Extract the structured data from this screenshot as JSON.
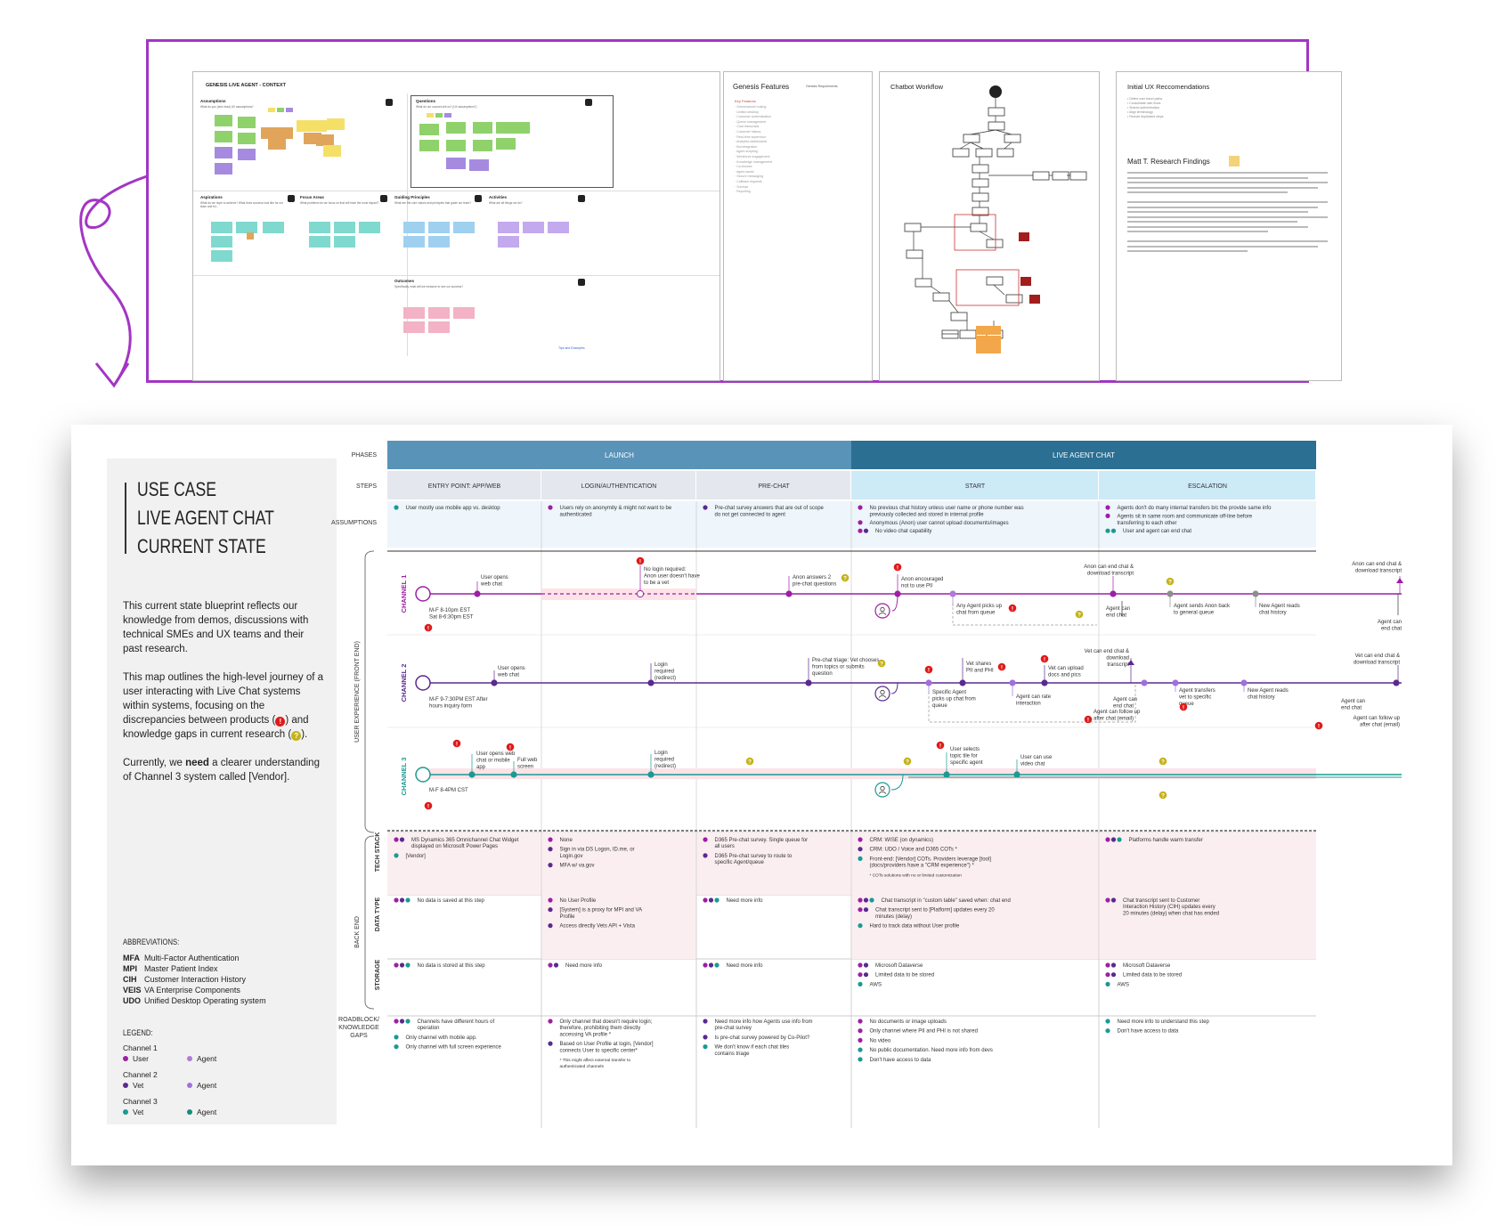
{
  "top": {
    "board_title": "GENESIS LIVE AGENT - CONTEXT",
    "sections": [
      {
        "title": "Assumptions",
        "sub": "What do you (tech lead) UX assumptions?"
      },
      {
        "title": "Questions",
        "sub": "What do our sources tell us? (UX assumptions?)"
      },
      {
        "title": "Aspirations",
        "sub": "What do we hope to achieve? What does success look like for our team and for..."
      },
      {
        "title": "Focus Areas",
        "sub": "What problems do we focus on that will have the most impact?"
      },
      {
        "title": "Guiding Principles",
        "sub": "What are the core values and principles that guide our team?"
      },
      {
        "title": "Activities",
        "sub": "What are all things we do?"
      },
      {
        "title": "Outcomes",
        "sub": "Specifically, what will we measure to see our success?"
      }
    ],
    "features_title": "Genesis Features",
    "features_small": "Genesis Requirements",
    "features_head": "Key Features",
    "features_items": [
      "Omnichannel routing",
      "Unified desktop",
      "Customer authentication",
      "Queue management",
      "Chat transcripts",
      "Customer history",
      "Real-time supervisor",
      "Analytics dashboards",
      "Bot integration",
      "Agent scripting",
      "Workforce engagement",
      "Knowledge management",
      "Co-browse",
      "Agent assist",
      "Secure messaging",
      "Callback requests",
      "Surveys",
      "Reporting"
    ],
    "chatbot_title": "Chatbot Workflow",
    "ux_title": "Initial UX Reccomendations",
    "ux_items": [
      "Define user travel paths",
      "Consolidate user flows",
      "Shared authentication",
      "Align terminology",
      "Reduce duplicated steps"
    ],
    "matt_title": "Matt T. Research Findings",
    "rec_tag": "Tips and Examples"
  },
  "sidebar": {
    "title_1": "USE CASE",
    "title_2": "LIVE AGENT CHAT",
    "title_3": "CURRENT STATE",
    "para1": "This current state blueprint reflects our knowledge from demos, discussions with technical SMEs and UX teams and their past research.",
    "para2_a": "This map outlines the high-level journey of a user interacting with Live Chat systems within systems, focusing on the discrepancies between products (",
    "para2_b": ") and knowledge gaps in current research (",
    "para2_c": ").",
    "para3_a": "Currently, we ",
    "para3_b": "need",
    "para3_c": " a clearer understanding of Channel 3 system called [Vendor].",
    "abbr_title": "ABBREVIATIONS:",
    "abbr": [
      {
        "k": "MFA",
        "v": "Multi-Factor Authentication"
      },
      {
        "k": "MPI",
        "v": "Master Patient Index"
      },
      {
        "k": "CIH",
        "v": "Customer Interaction History"
      },
      {
        "k": "VEIS",
        "v": "VA Enterprise Components"
      },
      {
        "k": "UDO",
        "v": "Unified Desktop Operating system"
      }
    ],
    "legend_title": "LEGEND:",
    "legend": [
      {
        "ch": "Channel 1",
        "a": "User",
        "b": "Agent",
        "ca": "#9d1fa5",
        "cb": "#b07ad8"
      },
      {
        "ch": "Channel 2",
        "a": "Vet",
        "b": "Agent",
        "ca": "#5a2a8f",
        "cb": "#a070de"
      },
      {
        "ch": "Channel 3",
        "a": "Vet",
        "b": "Agent",
        "ca": "#1a9a92",
        "cb": "#178a7d"
      }
    ]
  },
  "rows": {
    "phases": "PHASES",
    "steps": "STEPS",
    "assumptions": "ASSUMPTIONS",
    "ux": "USER EXPERIENCE (FRONT END)",
    "backend": "BACK END",
    "tech": "TECH STACK",
    "data": "DATA TYPE",
    "storage": "STORAGE",
    "roadblock_1": "ROADBLOCK/",
    "roadblock_2": "KNOWLEDGE",
    "roadblock_3": "GAPS"
  },
  "phases": [
    "LAUNCH",
    "LIVE AGENT CHAT"
  ],
  "steps": [
    "ENTRY POINT: APP/WEB",
    "LOGIN/AUTHENTICATION",
    "PRE-CHAT",
    "START",
    "ESCALATION"
  ],
  "channels": [
    "CHANNEL 1",
    "CHANNEL 2",
    "CHANNEL 3"
  ],
  "assumptions": [
    [
      "User mostly use mobile app vs. desktop"
    ],
    [
      "Users rely on anonymity & might not want to be authenticated"
    ],
    [
      "Pre-chat survey answers that are out of scope do not get connected to agent"
    ],
    [
      "No previous chat history unless user name or phone number was previously collected and stored in internal profile",
      "Anonymous (Anon) user cannot upload documents/images",
      "No video chat capability"
    ],
    [
      "Agents don't do many internal transfers b/c the provide same info",
      "Agents sit in same room and communicate off-line before transferring to each other",
      "User and agent can end chat"
    ]
  ],
  "ch1": {
    "hours": "M-F 8-10pm EST Sat 8-6:30pm EST",
    "labels": [
      "User opens web chat",
      "No login required: Anon user doesn't have to be a vet",
      "Anon answers 2 pre-chat questions",
      "Anon encouraged not to use PII",
      "Any Agent picks up chat from queue",
      "Agent can end chat",
      "Anon can end chat & download transcript",
      "Agent sends Anon back to general queue",
      "New Agent reads chat history",
      "Anon can end chat & download transcript",
      "Agent can end chat"
    ]
  },
  "ch2": {
    "hours": "M-F 9-7:30PM EST After hours inquiry form",
    "labels": [
      "User opens web chat",
      "Login required (redirect)",
      "Pre-chat triage: Vet chooses from topics or submits question",
      "Vet shares PII and PHI",
      "Vet can upload docs and pics",
      "Vet can end chat & download transcript",
      "Specific Agent picks up chat from queue",
      "Agent can rate interaction",
      "Agent can end chat",
      "Agent can follow up after chat (email)",
      "Agent transfers vet to specific queue",
      "New Agent reads chat history",
      "Vet can end chat & download transcript",
      "Agent can end chat",
      "Agent can follow up after chat (email)"
    ]
  },
  "ch3": {
    "hours": "M-F 8-4PM CST",
    "labels": [
      "User opens web chat or mobile app",
      "Full web screen",
      "Login required (redirect)",
      "User selects topic tile for specific agent",
      "User can use video chat"
    ]
  },
  "tech": [
    [
      "MS Dynamics 365 Omnichannel Chat Widget displayed on Microsoft Power Pages",
      "[Vendor]"
    ],
    [
      "None",
      "Sign in via DS Logon, ID.me, or Login.gov",
      "MFA w/ va.gov"
    ],
    [
      "D365 Pre-chat survey. Single queue for all users",
      "D365 Pre-chat survey to route to specific Agent/queue"
    ],
    [
      "CRM: WISE (on dynamics)",
      "CRM: UDO / Voice and D365 COTs *",
      "Front-end: [Vendor] COTs. Providers leverage [tool] (docs/providers have a \"CRM experience\") *",
      "* COTs solutions with no or limited customization"
    ],
    [
      "Platforms handle warm transfer"
    ]
  ],
  "datatype": [
    [
      "No data is saved at this step"
    ],
    [
      "No User Profile",
      "[System] is a proxy for MPI and VA Profile",
      "Access directly Vets API + Vista"
    ],
    [
      "Need more info"
    ],
    [
      "Chat transcript in \"custom table\" saved when: chat end",
      "Chat transcript sent to [Platform] updates every 20 minutes (delay)",
      "Hard to track data without User profile"
    ],
    [
      "Chat transcript sent to Customer Interaction History (CIH) updates every 20 minutes (delay) when chat has ended"
    ]
  ],
  "storage": [
    [
      "No data is stored at this step"
    ],
    [
      "Need more info"
    ],
    [
      "Need more info"
    ],
    [
      "Microsoft Dataverse",
      "Limited data to be stored",
      "AWS"
    ],
    [
      "Microsoft Dataverse",
      "Limited data to be stored",
      "AWS"
    ]
  ],
  "gaps": [
    [
      "Channels have different hours of operation",
      "Only channel with mobile app.",
      "Only channel with full screen experience"
    ],
    [
      "Only channel that doesn't require login; therefore, prohibiting them directly accessing VA profile *",
      "Based on User Profile at login, [Vendor] connects User to specific center*",
      "* This might affect external transfer to authenticated channels"
    ],
    [
      "Need more info how Agents use info from pre-chat survey",
      "Is pre-chat survey powered by Co-Pilot?",
      "We don't know if each chat tiles contains triage"
    ],
    [
      "No documents or image uploads",
      "Only channel where PII and PHI is not shared",
      "No video",
      "No public documentation. Need more info from devs",
      "Don't have access to data"
    ],
    [
      "Need more info to understand this step",
      "Don't have access to data"
    ]
  ],
  "colors": {
    "purple_frame": "#a335c4",
    "launch": "#5a93b8",
    "live": "#2b6f93",
    "step_launch": "#e4e8ee",
    "step_live": "#cdeaf7",
    "ch1": "#9d1fa5",
    "ch2": "#5a2a8f",
    "ch3": "#1a9a92",
    "red": "#e01a1a",
    "gold": "#c3b21c",
    "pink": "#fbeef0"
  }
}
